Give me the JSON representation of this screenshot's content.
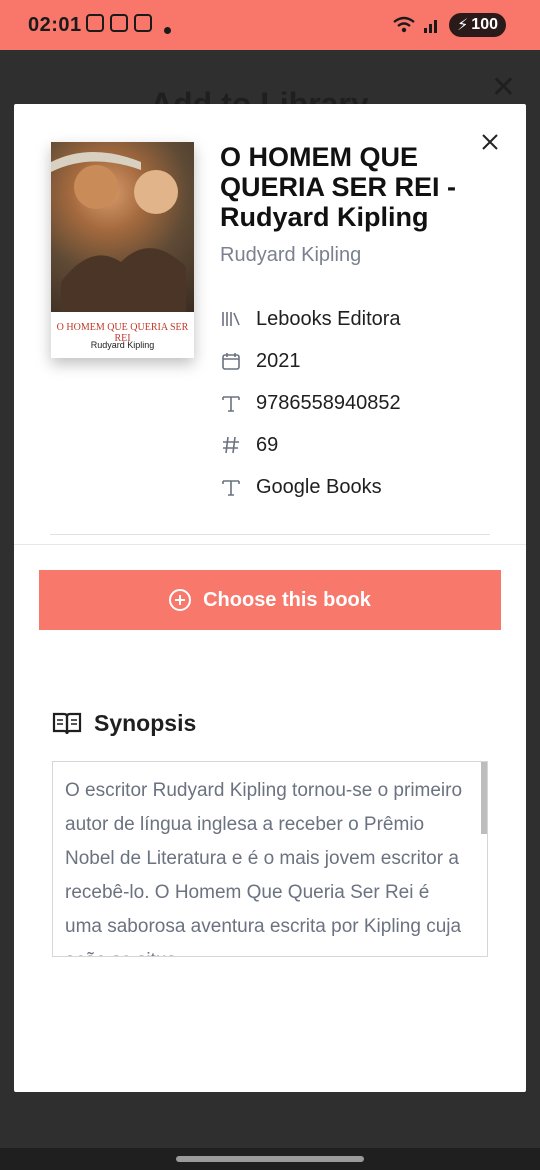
{
  "status_bar": {
    "time": "02:01",
    "battery": "100"
  },
  "backdrop": {
    "title": "Add to Library"
  },
  "book": {
    "title": "O HOMEM QUE QUERIA SER REI - Rudyard Kipling",
    "author": "Rudyard Kipling",
    "cover_title": "O HOMEM QUE QUERIA SER REI",
    "cover_author": "Rudyard Kipling",
    "meta": [
      {
        "icon": "library-icon",
        "text": "Lebooks Editora"
      },
      {
        "icon": "calendar-icon",
        "text": "2021"
      },
      {
        "icon": "text-icon",
        "text": "9786558940852"
      },
      {
        "icon": "hash-icon",
        "text": "69"
      },
      {
        "icon": "text-icon",
        "text": "Google Books"
      }
    ]
  },
  "actions": {
    "choose_label": "Choose this book"
  },
  "synopsis": {
    "heading": "Synopsis",
    "text": "O escritor Rudyard Kipling tornou-se o primeiro autor de língua inglesa a receber o Prêmio Nobel de Literatura e é o mais jovem escritor a recebê-lo. O Homem Que Queria Ser Rei é uma saborosa aventura escrita por Kipling cuja ação se situa..."
  },
  "colors": {
    "accent": "#f8786b",
    "status_bar": "#f8776a"
  }
}
